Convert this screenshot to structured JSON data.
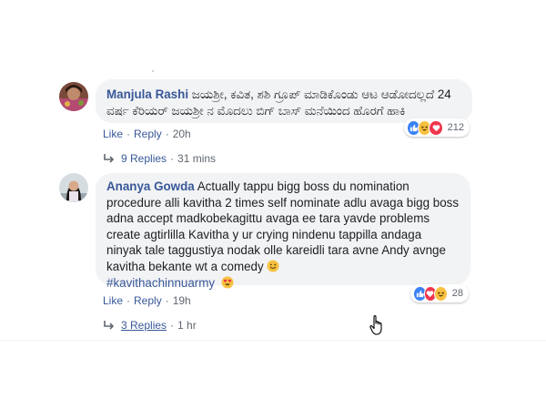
{
  "comments": [
    {
      "author": "Manjula Rashi",
      "text": "ಜಯಶ್ರೀ, ಕವಿತ, ಶಶಿ ಗ್ರೂಪ್ ಮಾಡಿಕೊಂಡು ಆಟ ಆಡೋದಲ್ಲದೆ 24 ವರ್ಷ ಕೆರಿಯರ್ ಜಯಶ್ರೀ ನ ಮೊದಲು ಬಿಗ್ ಬಾಸ್ ಮನೆಯಿಂದ ಹೊರಗೆ ಹಾಕಿ",
      "like_label": "Like",
      "reply_label": "Reply",
      "time": "20h",
      "reaction_count": "212",
      "replies_label": "9 Replies",
      "replies_time": "31 mins"
    },
    {
      "author": "Ananya Gowda",
      "text": "Actually tappu bigg boss du nomination procedure alli kavitha 2 times self nominate adlu avaga bigg boss adna accept madkobekagittu avaga ee tara yavde problems create agtirlilla Kavitha y ur crying nindenu tappilla andaga ninyak tale taggustiya nodak olle kareidli tara avne Andy avnge kavitha bekante wt a comedy",
      "hashtag": "#kavithachinnuarmy",
      "like_label": "Like",
      "reply_label": "Reply",
      "time": "19h",
      "reaction_count": "28",
      "replies_label": "3 Replies",
      "replies_time": "1 hr"
    }
  ],
  "icons": [
    "like-reaction-icon",
    "haha-reaction-icon",
    "love-reaction-icon",
    "reply-arrow-icon",
    "hand-cursor-icon",
    "grinning-emoji-icon",
    "heart-eyes-emoji-icon"
  ],
  "colors": {
    "link": "#385898",
    "bubble": "#f2f3f5",
    "meta": "#606770",
    "like": "#3b82f6",
    "love": "#f0364e",
    "haha": "#f7c242"
  }
}
